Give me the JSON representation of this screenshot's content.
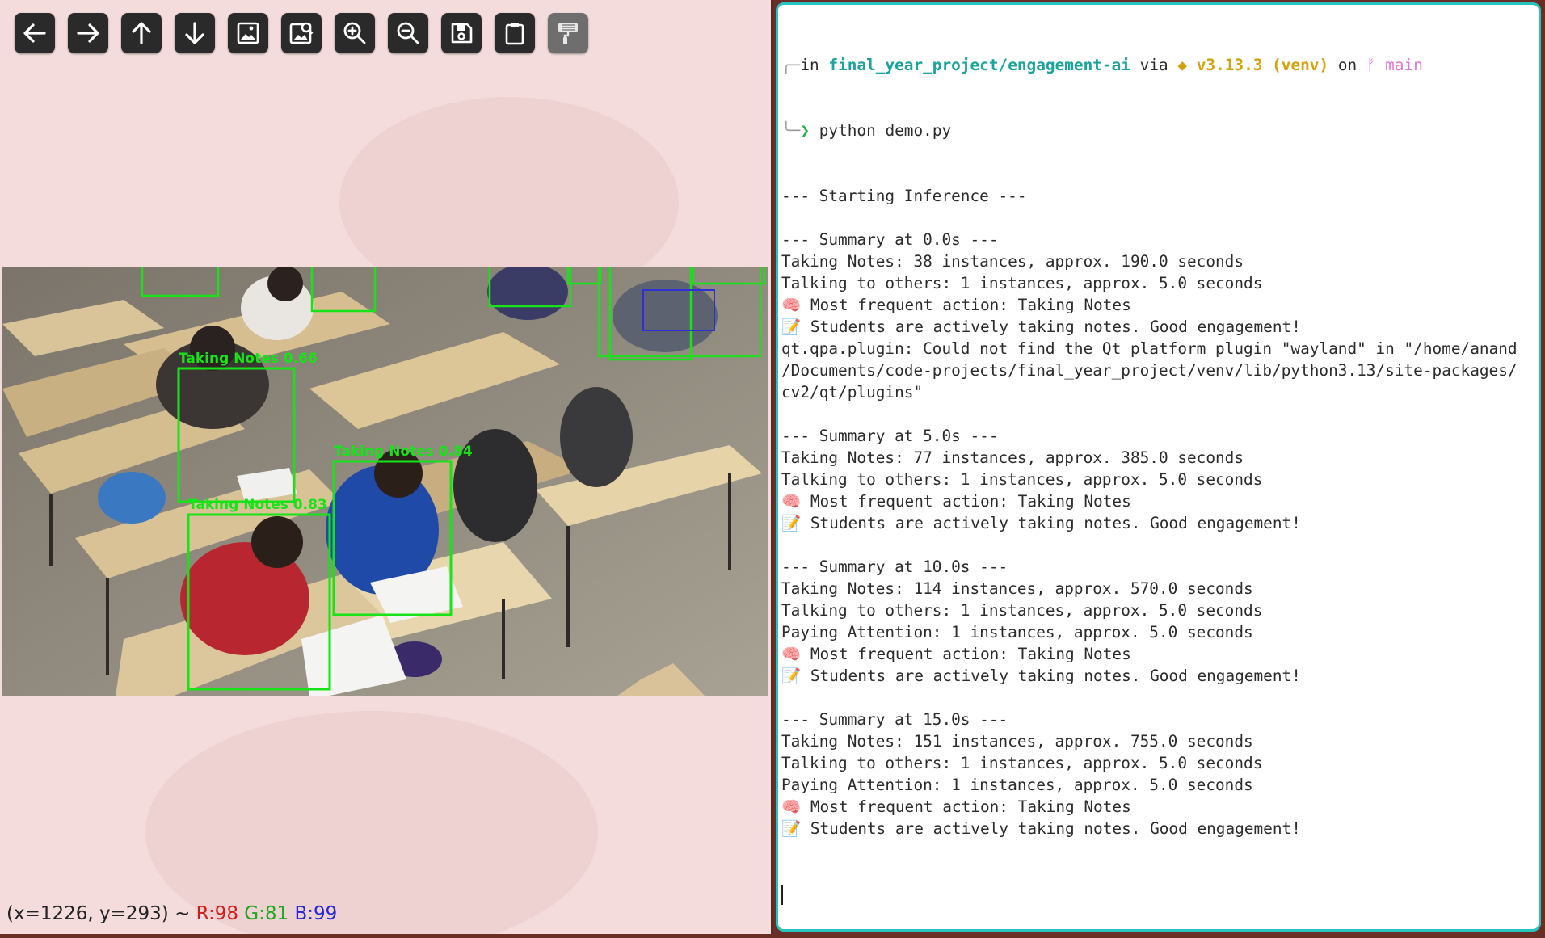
{
  "viewer": {
    "toolbar": [
      {
        "name": "back-arrow-icon",
        "label": "Pan left"
      },
      {
        "name": "forward-arrow-icon",
        "label": "Pan right"
      },
      {
        "name": "up-arrow-icon",
        "label": "Pan up"
      },
      {
        "name": "down-arrow-icon",
        "label": "Pan down"
      },
      {
        "name": "image-icon",
        "label": "Zoom in"
      },
      {
        "name": "image-search-icon",
        "label": "Zoom to fit"
      },
      {
        "name": "zoom-in-icon",
        "label": "Zoom in"
      },
      {
        "name": "zoom-out-icon",
        "label": "Zoom out"
      },
      {
        "name": "save-icon",
        "label": "Save image"
      },
      {
        "name": "clipboard-icon",
        "label": "Copy to clipboard"
      },
      {
        "name": "paint-roller-icon",
        "label": "Properties"
      }
    ],
    "detections": [
      {
        "label": "Taking Notes 0.66"
      },
      {
        "label": "Taking Notes 0.84"
      },
      {
        "label": "Taking Notes 0.83"
      }
    ],
    "status": {
      "coords": "(x=1226, y=293) ~",
      "r": "R:98",
      "g": "G:81",
      "b": "B:99"
    },
    "colors": {
      "box": "#18e318",
      "red": "#d41b1b",
      "green": "#1ea81e",
      "blue": "#2424d8"
    }
  },
  "terminal": {
    "prompt": {
      "in": "in ",
      "path": "final_year_project/engagement-ai",
      "via": " via ",
      "python_icon": "◆",
      "python": " v3.13.3 (venv)",
      "on": " on ",
      "branch_icon": "ᚠ",
      "branch": " main",
      "arrow": "❯",
      "command": "python demo.py"
    },
    "lines": [
      "--- Starting Inference ---",
      "",
      "--- Summary at 0.0s ---",
      "Taking Notes: 38 instances, approx. 190.0 seconds",
      "Talking to others: 1 instances, approx. 5.0 seconds",
      "🧠 Most frequent action: Taking Notes",
      "📝 Students are actively taking notes. Good engagement!",
      "qt.qpa.plugin: Could not find the Qt platform plugin \"wayland\" in \"/home/anand",
      "/Documents/code-projects/final_year_project/venv/lib/python3.13/site-packages/",
      "cv2/qt/plugins\"",
      "",
      "--- Summary at 5.0s ---",
      "Taking Notes: 77 instances, approx. 385.0 seconds",
      "Talking to others: 1 instances, approx. 5.0 seconds",
      "🧠 Most frequent action: Taking Notes",
      "📝 Students are actively taking notes. Good engagement!",
      "",
      "--- Summary at 10.0s ---",
      "Taking Notes: 114 instances, approx. 570.0 seconds",
      "Talking to others: 1 instances, approx. 5.0 seconds",
      "Paying Attention: 1 instances, approx. 5.0 seconds",
      "🧠 Most frequent action: Taking Notes",
      "📝 Students are actively taking notes. Good engagement!",
      "",
      "--- Summary at 15.0s ---",
      "Taking Notes: 151 instances, approx. 755.0 seconds",
      "Talking to others: 1 instances, approx. 5.0 seconds",
      "Paying Attention: 1 instances, approx. 5.0 seconds",
      "🧠 Most frequent action: Taking Notes",
      "📝 Students are actively taking notes. Good engagement!"
    ],
    "colors": {
      "border": "#27c4bf",
      "path": "#1ba39c",
      "python": "#d4a20e",
      "branch": "#e07ad9"
    }
  }
}
